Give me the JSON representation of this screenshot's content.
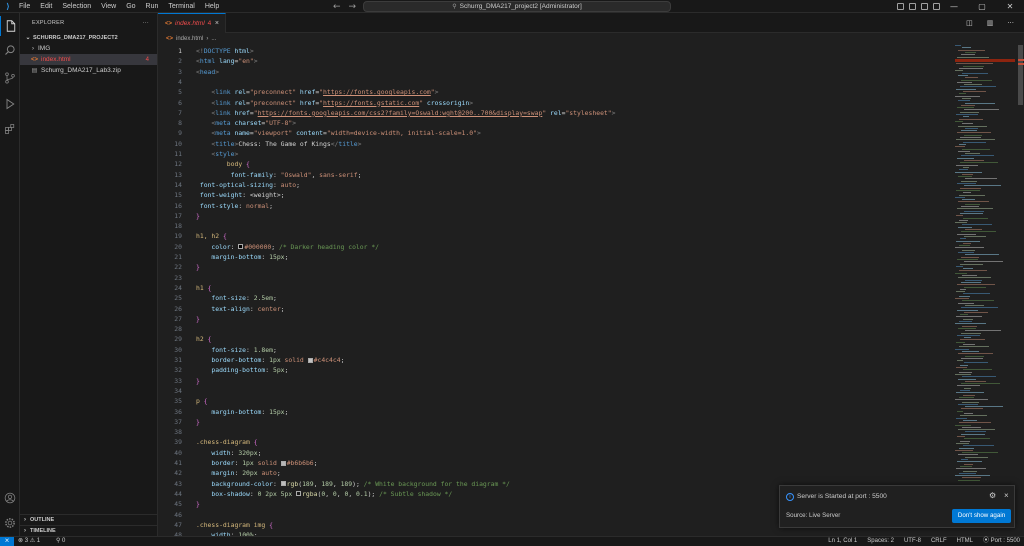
{
  "titlebar": {
    "menu": [
      "File",
      "Edit",
      "Selection",
      "View",
      "Go",
      "Run",
      "Terminal",
      "Help"
    ],
    "command_center": "Schurrg_DMA217_project2 [Administrator]"
  },
  "sidebar": {
    "title": "EXPLORER",
    "more": "···",
    "folder": "SCHURRG_DMA217_PROJECT2",
    "items": [
      {
        "label": "IMG",
        "type": "folder"
      },
      {
        "label": "index.html",
        "type": "html",
        "badge": "4"
      },
      {
        "label": "Schurrg_DMA217_Lab3.zip",
        "type": "zip"
      }
    ],
    "outline": "OUTLINE",
    "timeline": "TIMELINE"
  },
  "editor": {
    "tab": {
      "label": "index.html",
      "badge": "4",
      "close": "×"
    },
    "breadcrumb": [
      "index.html",
      "..."
    ],
    "lines": [
      [
        [
          "k-punc",
          "<!"
        ],
        [
          "k-tag",
          "DOCTYPE"
        ],
        [
          "k-attr",
          " html"
        ],
        [
          "k-punc",
          ">"
        ]
      ],
      [
        [
          "k-punc",
          "<"
        ],
        [
          "k-tag",
          "html"
        ],
        [
          "k-attr",
          " lang"
        ],
        [
          "k-plain",
          "="
        ],
        [
          "k-str",
          "\"en\""
        ],
        [
          "k-punc",
          ">"
        ]
      ],
      [
        [
          "k-punc",
          "<"
        ],
        [
          "k-tag",
          "head"
        ],
        [
          "k-punc",
          ">"
        ]
      ],
      [],
      [
        [
          "k-plain",
          "    "
        ],
        [
          "k-punc",
          "<"
        ],
        [
          "k-tag",
          "link"
        ],
        [
          "k-attr",
          " rel"
        ],
        [
          "k-plain",
          "="
        ],
        [
          "k-str",
          "\"preconnect\""
        ],
        [
          "k-attr",
          " href"
        ],
        [
          "k-plain",
          "="
        ],
        [
          "k-str",
          "\""
        ],
        [
          "k-lnk",
          "https://fonts.googleapis.com"
        ],
        [
          "k-str",
          "\""
        ],
        [
          "k-punc",
          ">"
        ]
      ],
      [
        [
          "k-plain",
          "    "
        ],
        [
          "k-punc",
          "<"
        ],
        [
          "k-tag",
          "link"
        ],
        [
          "k-attr",
          " rel"
        ],
        [
          "k-plain",
          "="
        ],
        [
          "k-str",
          "\"preconnect\""
        ],
        [
          "k-attr",
          " href"
        ],
        [
          "k-plain",
          "="
        ],
        [
          "k-str",
          "\""
        ],
        [
          "k-lnk",
          "https://fonts.gstatic.com"
        ],
        [
          "k-str",
          "\""
        ],
        [
          "k-attr",
          " crossorigin"
        ],
        [
          "k-punc",
          ">"
        ]
      ],
      [
        [
          "k-plain",
          "    "
        ],
        [
          "k-punc",
          "<"
        ],
        [
          "k-tag",
          "link"
        ],
        [
          "k-attr",
          " href"
        ],
        [
          "k-plain",
          "="
        ],
        [
          "k-str",
          "\""
        ],
        [
          "k-lnk",
          "https://fonts.googleapis.com/css2?family=Oswald:wght@200..700&display=swap"
        ],
        [
          "k-str",
          "\""
        ],
        [
          "k-attr",
          " rel"
        ],
        [
          "k-plain",
          "="
        ],
        [
          "k-str",
          "\"stylesheet\""
        ],
        [
          "k-punc",
          ">"
        ]
      ],
      [
        [
          "k-plain",
          "    "
        ],
        [
          "k-punc",
          "<"
        ],
        [
          "k-tag",
          "meta"
        ],
        [
          "k-attr",
          " charset"
        ],
        [
          "k-plain",
          "="
        ],
        [
          "k-str",
          "\"UTF-8\""
        ],
        [
          "k-punc",
          ">"
        ]
      ],
      [
        [
          "k-plain",
          "    "
        ],
        [
          "k-punc",
          "<"
        ],
        [
          "k-tag",
          "meta"
        ],
        [
          "k-attr",
          " name"
        ],
        [
          "k-plain",
          "="
        ],
        [
          "k-str",
          "\"viewport\""
        ],
        [
          "k-attr",
          " content"
        ],
        [
          "k-plain",
          "="
        ],
        [
          "k-str",
          "\"width=device-width, initial-scale=1.0\""
        ],
        [
          "k-punc",
          ">"
        ]
      ],
      [
        [
          "k-plain",
          "    "
        ],
        [
          "k-punc",
          "<"
        ],
        [
          "k-tag",
          "title"
        ],
        [
          "k-punc",
          ">"
        ],
        [
          "k-plain",
          "Chess: The Game of Kings"
        ],
        [
          "k-punc",
          "</"
        ],
        [
          "k-tag",
          "title"
        ],
        [
          "k-punc",
          ">"
        ]
      ],
      [
        [
          "k-plain",
          "    "
        ],
        [
          "k-punc",
          "<"
        ],
        [
          "k-tag",
          "style"
        ],
        [
          "k-punc",
          ">"
        ]
      ],
      [
        [
          "k-plain",
          "        "
        ],
        [
          "k-sel",
          "body"
        ],
        [
          "k-plain",
          " "
        ],
        [
          "k-brace",
          "{"
        ]
      ],
      [
        [
          "k-plain",
          "         "
        ],
        [
          "k-prop",
          "font-family"
        ],
        [
          "k-plain",
          ": "
        ],
        [
          "k-val",
          "\"Oswald\""
        ],
        [
          "k-plain",
          ", "
        ],
        [
          "k-val",
          "sans-serif"
        ],
        [
          "k-plain",
          ";"
        ]
      ],
      [
        [
          "k-plain",
          " "
        ],
        [
          "k-prop",
          "font-optical-sizing"
        ],
        [
          "k-plain",
          ": "
        ],
        [
          "k-val",
          "auto"
        ],
        [
          "k-plain",
          ";"
        ]
      ],
      [
        [
          "k-plain",
          " "
        ],
        [
          "k-prop",
          "font-weight"
        ],
        [
          "k-plain",
          ": "
        ],
        [
          "k-plain",
          "<weight>;"
        ]
      ],
      [
        [
          "k-plain",
          " "
        ],
        [
          "k-prop",
          "font-style"
        ],
        [
          "k-plain",
          ": "
        ],
        [
          "k-val",
          "normal"
        ],
        [
          "k-plain",
          ";"
        ]
      ],
      [
        [
          "k-brace",
          "}"
        ]
      ],
      [],
      [
        [
          "k-sel",
          "h1, h2"
        ],
        [
          "k-plain",
          " "
        ],
        [
          "k-brace",
          "{"
        ]
      ],
      [
        [
          "k-plain",
          "    "
        ],
        [
          "k-prop",
          "color"
        ],
        [
          "k-plain",
          ": "
        ],
        [
          "sw",
          "#000000"
        ],
        [
          "k-val",
          "#000000"
        ],
        [
          "k-plain",
          "; "
        ],
        [
          "k-com",
          "/* Darker heading color */"
        ]
      ],
      [
        [
          "k-plain",
          "    "
        ],
        [
          "k-prop",
          "margin-bottom"
        ],
        [
          "k-plain",
          ": "
        ],
        [
          "k-num",
          "15px"
        ],
        [
          "k-plain",
          ";"
        ]
      ],
      [
        [
          "k-brace",
          "}"
        ]
      ],
      [],
      [
        [
          "k-sel",
          "h1"
        ],
        [
          "k-plain",
          " "
        ],
        [
          "k-brace",
          "{"
        ]
      ],
      [
        [
          "k-plain",
          "    "
        ],
        [
          "k-prop",
          "font-size"
        ],
        [
          "k-plain",
          ": "
        ],
        [
          "k-num",
          "2.5em"
        ],
        [
          "k-plain",
          ";"
        ]
      ],
      [
        [
          "k-plain",
          "    "
        ],
        [
          "k-prop",
          "text-align"
        ],
        [
          "k-plain",
          ": "
        ],
        [
          "k-val",
          "center"
        ],
        [
          "k-plain",
          ";"
        ]
      ],
      [
        [
          "k-brace",
          "}"
        ]
      ],
      [],
      [
        [
          "k-sel",
          "h2"
        ],
        [
          "k-plain",
          " "
        ],
        [
          "k-brace",
          "{"
        ]
      ],
      [
        [
          "k-plain",
          "    "
        ],
        [
          "k-prop",
          "font-size"
        ],
        [
          "k-plain",
          ": "
        ],
        [
          "k-num",
          "1.8em"
        ],
        [
          "k-plain",
          ";"
        ]
      ],
      [
        [
          "k-plain",
          "    "
        ],
        [
          "k-prop",
          "border-bottom"
        ],
        [
          "k-plain",
          ": "
        ],
        [
          "k-num",
          "1px"
        ],
        [
          "k-plain",
          " "
        ],
        [
          "k-val",
          "solid"
        ],
        [
          "k-plain",
          " "
        ],
        [
          "sw",
          "#c4c4c4"
        ],
        [
          "k-val",
          "#c4c4c4"
        ],
        [
          "k-plain",
          ";"
        ]
      ],
      [
        [
          "k-plain",
          "    "
        ],
        [
          "k-prop",
          "padding-bottom"
        ],
        [
          "k-plain",
          ": "
        ],
        [
          "k-num",
          "5px"
        ],
        [
          "k-plain",
          ";"
        ]
      ],
      [
        [
          "k-brace",
          "}"
        ]
      ],
      [],
      [
        [
          "k-sel",
          "p"
        ],
        [
          "k-plain",
          " "
        ],
        [
          "k-brace",
          "{"
        ]
      ],
      [
        [
          "k-plain",
          "    "
        ],
        [
          "k-prop",
          "margin-bottom"
        ],
        [
          "k-plain",
          ": "
        ],
        [
          "k-num",
          "15px"
        ],
        [
          "k-plain",
          ";"
        ]
      ],
      [
        [
          "k-brace",
          "}"
        ]
      ],
      [],
      [
        [
          "k-sel",
          ".chess-diagram"
        ],
        [
          "k-plain",
          " "
        ],
        [
          "k-brace",
          "{"
        ]
      ],
      [
        [
          "k-plain",
          "    "
        ],
        [
          "k-prop",
          "width"
        ],
        [
          "k-plain",
          ": "
        ],
        [
          "k-num",
          "320px"
        ],
        [
          "k-plain",
          ";"
        ]
      ],
      [
        [
          "k-plain",
          "    "
        ],
        [
          "k-prop",
          "border"
        ],
        [
          "k-plain",
          ": "
        ],
        [
          "k-num",
          "1px"
        ],
        [
          "k-plain",
          " "
        ],
        [
          "k-val",
          "solid"
        ],
        [
          "k-plain",
          " "
        ],
        [
          "sw",
          "#b6b6b6"
        ],
        [
          "k-val",
          "#b6b6b6"
        ],
        [
          "k-plain",
          ";"
        ]
      ],
      [
        [
          "k-plain",
          "    "
        ],
        [
          "k-prop",
          "margin"
        ],
        [
          "k-plain",
          ": "
        ],
        [
          "k-num",
          "20px"
        ],
        [
          "k-plain",
          " "
        ],
        [
          "k-val",
          "auto"
        ],
        [
          "k-plain",
          ";"
        ]
      ],
      [
        [
          "k-plain",
          "    "
        ],
        [
          "k-prop",
          "background-color"
        ],
        [
          "k-plain",
          ": "
        ],
        [
          "sw",
          "#bdbdbd"
        ],
        [
          "k-fn",
          "rgb"
        ],
        [
          "k-plain",
          "("
        ],
        [
          "k-num",
          "189"
        ],
        [
          "k-plain",
          ", "
        ],
        [
          "k-num",
          "189"
        ],
        [
          "k-plain",
          ", "
        ],
        [
          "k-num",
          "189"
        ],
        [
          "k-plain",
          "); "
        ],
        [
          "k-com",
          "/* White background for the diagram */"
        ]
      ],
      [
        [
          "k-plain",
          "    "
        ],
        [
          "k-prop",
          "box-shadow"
        ],
        [
          "k-plain",
          ": "
        ],
        [
          "k-num",
          "0 2px 5px"
        ],
        [
          "k-plain",
          " "
        ],
        [
          "sw",
          "#1a1a1a"
        ],
        [
          "k-fn",
          "rgba"
        ],
        [
          "k-plain",
          "("
        ],
        [
          "k-num",
          "0"
        ],
        [
          "k-plain",
          ", "
        ],
        [
          "k-num",
          "0"
        ],
        [
          "k-plain",
          ", "
        ],
        [
          "k-num",
          "0"
        ],
        [
          "k-plain",
          ", "
        ],
        [
          "k-num",
          "0.1"
        ],
        [
          "k-plain",
          "); "
        ],
        [
          "k-com",
          "/* Subtle shadow */"
        ]
      ],
      [
        [
          "k-brace",
          "}"
        ]
      ],
      [],
      [
        [
          "k-sel",
          ".chess-diagram img"
        ],
        [
          "k-plain",
          " "
        ],
        [
          "k-brace",
          "{"
        ]
      ],
      [
        [
          "k-plain",
          "    "
        ],
        [
          "k-prop",
          "width"
        ],
        [
          "k-plain",
          ": "
        ],
        [
          "k-num",
          "100%"
        ],
        [
          "k-plain",
          ";"
        ]
      ]
    ]
  },
  "notification": {
    "info_icon": "info-icon",
    "message": "Server is Started at port : 5500",
    "source": "Source: Live Server",
    "button": "Don't show again",
    "close": "×"
  },
  "statusbar": {
    "remote": "⨯",
    "problems": "⊗ 3 ⚠ 1",
    "ports": "⚲ 0",
    "right": [
      "Ln 1, Col 1",
      "Spaces: 2",
      "UTF-8",
      "CRLF",
      "HTML",
      "⦿ Port : 5500"
    ]
  },
  "colors": {
    "accent": "#0078d4",
    "error": "#f14c4c",
    "background": "#1f1f1f",
    "sidebar": "#181818"
  }
}
